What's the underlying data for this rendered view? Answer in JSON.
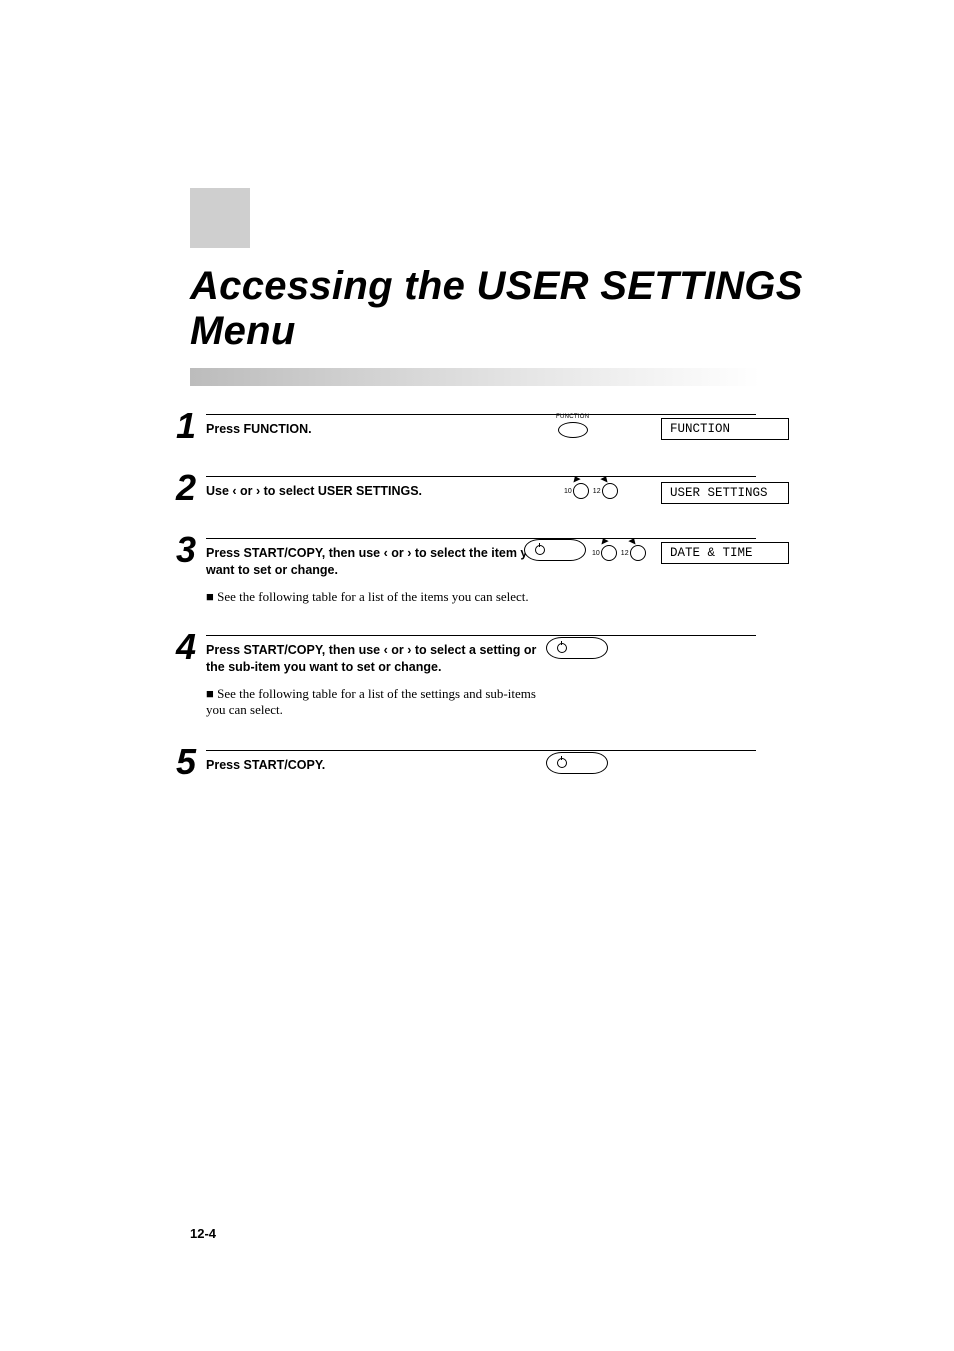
{
  "title": {
    "line1": "Accessing the USER SETTINGS",
    "line2": "Menu"
  },
  "page_number": "12-4",
  "icons": {
    "function_label": "FUNCTION",
    "keypad_10": "10",
    "keypad_12": "12"
  },
  "steps": [
    {
      "num": "1",
      "instruction": "Press FUNCTION.",
      "display": "FUNCTION",
      "show_function_button": true,
      "show_arrows": false,
      "show_startcopy": false,
      "show_display": true
    },
    {
      "num": "2",
      "instruction": "Use ‹ or › to select USER SETTINGS.",
      "display": "USER SETTINGS",
      "show_function_button": false,
      "show_arrows": true,
      "show_startcopy": false,
      "show_display": true
    },
    {
      "num": "3",
      "instruction": "Press START/COPY, then use ‹ or › to select the item you want to set or change.",
      "note": "See the following table for a list of the items you can select.",
      "display": "DATE & TIME",
      "show_function_button": false,
      "show_arrows": true,
      "show_startcopy": true,
      "show_display": true
    },
    {
      "num": "4",
      "instruction": "Press START/COPY, then use ‹ or › to select a setting or the sub-item you want to set or change.",
      "note": "See the following table for a list of the settings and sub-items you can select.",
      "show_function_button": false,
      "show_arrows": false,
      "show_startcopy": true,
      "show_display": false
    },
    {
      "num": "5",
      "instruction": "Press START/COPY.",
      "show_function_button": false,
      "show_arrows": false,
      "show_startcopy": true,
      "show_display": false
    }
  ]
}
